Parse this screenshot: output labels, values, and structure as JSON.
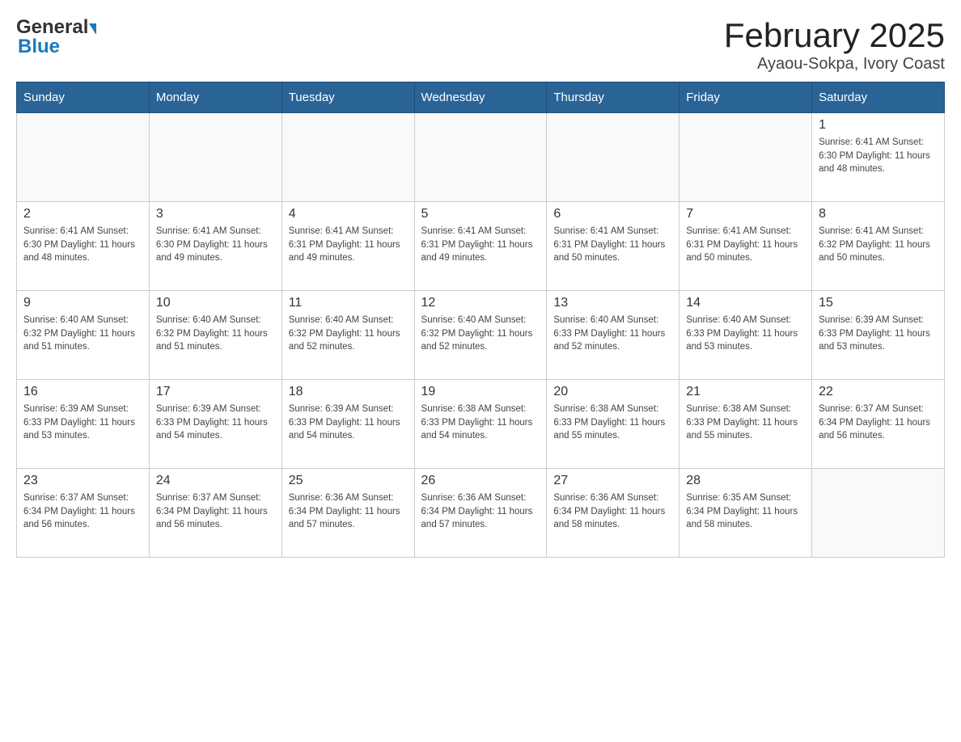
{
  "header": {
    "title": "February 2025",
    "subtitle": "Ayaou-Sokpa, Ivory Coast",
    "logo_general": "General",
    "logo_blue": "Blue"
  },
  "weekdays": [
    "Sunday",
    "Monday",
    "Tuesday",
    "Wednesday",
    "Thursday",
    "Friday",
    "Saturday"
  ],
  "weeks": [
    [
      {
        "day": "",
        "info": ""
      },
      {
        "day": "",
        "info": ""
      },
      {
        "day": "",
        "info": ""
      },
      {
        "day": "",
        "info": ""
      },
      {
        "day": "",
        "info": ""
      },
      {
        "day": "",
        "info": ""
      },
      {
        "day": "1",
        "info": "Sunrise: 6:41 AM\nSunset: 6:30 PM\nDaylight: 11 hours\nand 48 minutes."
      }
    ],
    [
      {
        "day": "2",
        "info": "Sunrise: 6:41 AM\nSunset: 6:30 PM\nDaylight: 11 hours\nand 48 minutes."
      },
      {
        "day": "3",
        "info": "Sunrise: 6:41 AM\nSunset: 6:30 PM\nDaylight: 11 hours\nand 49 minutes."
      },
      {
        "day": "4",
        "info": "Sunrise: 6:41 AM\nSunset: 6:31 PM\nDaylight: 11 hours\nand 49 minutes."
      },
      {
        "day": "5",
        "info": "Sunrise: 6:41 AM\nSunset: 6:31 PM\nDaylight: 11 hours\nand 49 minutes."
      },
      {
        "day": "6",
        "info": "Sunrise: 6:41 AM\nSunset: 6:31 PM\nDaylight: 11 hours\nand 50 minutes."
      },
      {
        "day": "7",
        "info": "Sunrise: 6:41 AM\nSunset: 6:31 PM\nDaylight: 11 hours\nand 50 minutes."
      },
      {
        "day": "8",
        "info": "Sunrise: 6:41 AM\nSunset: 6:32 PM\nDaylight: 11 hours\nand 50 minutes."
      }
    ],
    [
      {
        "day": "9",
        "info": "Sunrise: 6:40 AM\nSunset: 6:32 PM\nDaylight: 11 hours\nand 51 minutes."
      },
      {
        "day": "10",
        "info": "Sunrise: 6:40 AM\nSunset: 6:32 PM\nDaylight: 11 hours\nand 51 minutes."
      },
      {
        "day": "11",
        "info": "Sunrise: 6:40 AM\nSunset: 6:32 PM\nDaylight: 11 hours\nand 52 minutes."
      },
      {
        "day": "12",
        "info": "Sunrise: 6:40 AM\nSunset: 6:32 PM\nDaylight: 11 hours\nand 52 minutes."
      },
      {
        "day": "13",
        "info": "Sunrise: 6:40 AM\nSunset: 6:33 PM\nDaylight: 11 hours\nand 52 minutes."
      },
      {
        "day": "14",
        "info": "Sunrise: 6:40 AM\nSunset: 6:33 PM\nDaylight: 11 hours\nand 53 minutes."
      },
      {
        "day": "15",
        "info": "Sunrise: 6:39 AM\nSunset: 6:33 PM\nDaylight: 11 hours\nand 53 minutes."
      }
    ],
    [
      {
        "day": "16",
        "info": "Sunrise: 6:39 AM\nSunset: 6:33 PM\nDaylight: 11 hours\nand 53 minutes."
      },
      {
        "day": "17",
        "info": "Sunrise: 6:39 AM\nSunset: 6:33 PM\nDaylight: 11 hours\nand 54 minutes."
      },
      {
        "day": "18",
        "info": "Sunrise: 6:39 AM\nSunset: 6:33 PM\nDaylight: 11 hours\nand 54 minutes."
      },
      {
        "day": "19",
        "info": "Sunrise: 6:38 AM\nSunset: 6:33 PM\nDaylight: 11 hours\nand 54 minutes."
      },
      {
        "day": "20",
        "info": "Sunrise: 6:38 AM\nSunset: 6:33 PM\nDaylight: 11 hours\nand 55 minutes."
      },
      {
        "day": "21",
        "info": "Sunrise: 6:38 AM\nSunset: 6:33 PM\nDaylight: 11 hours\nand 55 minutes."
      },
      {
        "day": "22",
        "info": "Sunrise: 6:37 AM\nSunset: 6:34 PM\nDaylight: 11 hours\nand 56 minutes."
      }
    ],
    [
      {
        "day": "23",
        "info": "Sunrise: 6:37 AM\nSunset: 6:34 PM\nDaylight: 11 hours\nand 56 minutes."
      },
      {
        "day": "24",
        "info": "Sunrise: 6:37 AM\nSunset: 6:34 PM\nDaylight: 11 hours\nand 56 minutes."
      },
      {
        "day": "25",
        "info": "Sunrise: 6:36 AM\nSunset: 6:34 PM\nDaylight: 11 hours\nand 57 minutes."
      },
      {
        "day": "26",
        "info": "Sunrise: 6:36 AM\nSunset: 6:34 PM\nDaylight: 11 hours\nand 57 minutes."
      },
      {
        "day": "27",
        "info": "Sunrise: 6:36 AM\nSunset: 6:34 PM\nDaylight: 11 hours\nand 58 minutes."
      },
      {
        "day": "28",
        "info": "Sunrise: 6:35 AM\nSunset: 6:34 PM\nDaylight: 11 hours\nand 58 minutes."
      },
      {
        "day": "",
        "info": ""
      }
    ]
  ]
}
